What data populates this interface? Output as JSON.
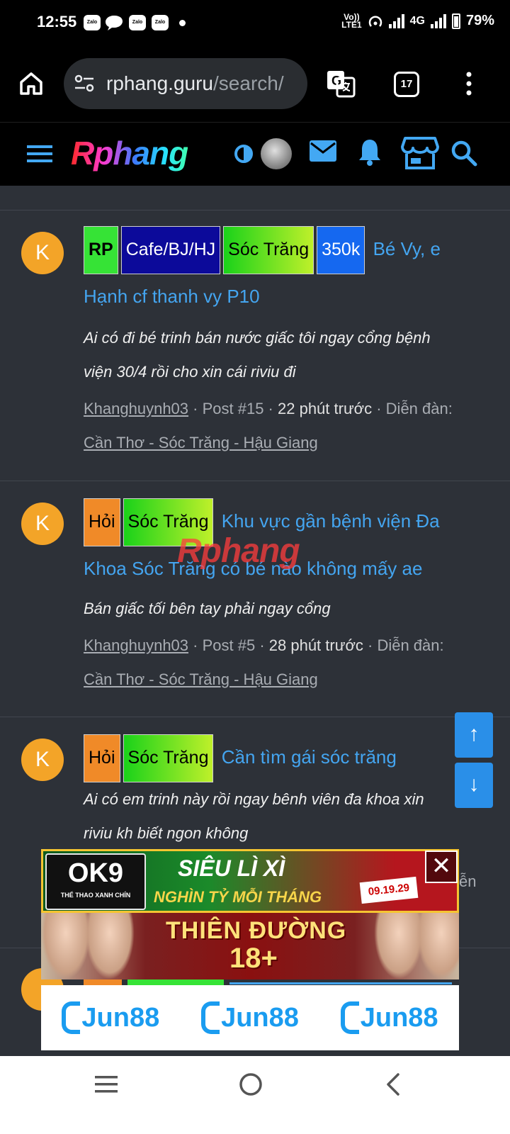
{
  "status_bar": {
    "time": "12:55",
    "apps": [
      "Zalo",
      "Zalo",
      "Zalo"
    ],
    "volte_top": "Vo))",
    "volte_bottom": "LTE1",
    "network": "4G",
    "battery": "79%"
  },
  "browser": {
    "url_host": "rphang.guru",
    "url_path": "/search/",
    "tab_count": "17"
  },
  "site_header": {
    "logo": "Rphang"
  },
  "posts": [
    {
      "avatar_letter": "K",
      "tags": [
        "RP",
        "Cafe/BJ/HJ",
        "Sóc Trăng",
        "350k"
      ],
      "title_part1": "Bé Vy, e",
      "title_part2": "Hạnh cf thanh vy P10",
      "snippet_line1": "Ai có đi bé trinh bán nước giấc tôi ngay cổng bệnh",
      "snippet_line2": "viện 30/4 rồi cho xin cái riviu đi",
      "author": "Khanghuynh03",
      "post_no": "Post #15",
      "time": "22 phút trước",
      "forum_label": "Diễn đàn:",
      "forum": "Cần Thơ - Sóc Trăng - Hậu Giang"
    },
    {
      "avatar_letter": "K",
      "tags": [
        "Hỏi",
        "Sóc Trăng"
      ],
      "title_part1": "Khu vực gần bệnh viện Đa",
      "title_part2": "Khoa Sóc Trăng có bé nào không mấy ae",
      "snippet_line1": "Bán giấc tối bên tay phải ngay cổng",
      "author": "Khanghuynh03",
      "post_no": "Post #5",
      "time": "28 phút trước",
      "forum_label": "Diễn đàn:",
      "forum": "Cần Thơ - Sóc Trăng - Hậu Giang"
    },
    {
      "avatar_letter": "K",
      "tags": [
        "Hỏi",
        "Sóc Trăng"
      ],
      "title_part1": "Cần tìm gái sóc trăng",
      "snippet_line1": "Ai có em trinh này rồi ngay bênh viên đa khoa xin",
      "snippet_line2": "riviu kh biết ngon không",
      "meta_fragment": "ễn"
    }
  ],
  "watermark": "Rphang",
  "scroll": {
    "up": "↑",
    "down": "↓"
  },
  "ads": {
    "ad1": {
      "logo": "OK9",
      "logo_sub": "THỂ THAO XANH CHÍN",
      "line1": "SIÊU LÌ XÌ",
      "line2": "NGHÌN TỶ MỖI THÁNG",
      "date": "09.19.29"
    },
    "close": "✕",
    "ad2": {
      "line1": "THIÊN ĐƯỜNG",
      "line2": "18+"
    },
    "ad3": {
      "brand": [
        "Jun88",
        "Jun88",
        "Jun88"
      ]
    }
  },
  "colors": {
    "background": "#2d3138",
    "link": "#44a5f0",
    "avatar": "#f3a428",
    "scroll_button": "#2a8fe8"
  }
}
